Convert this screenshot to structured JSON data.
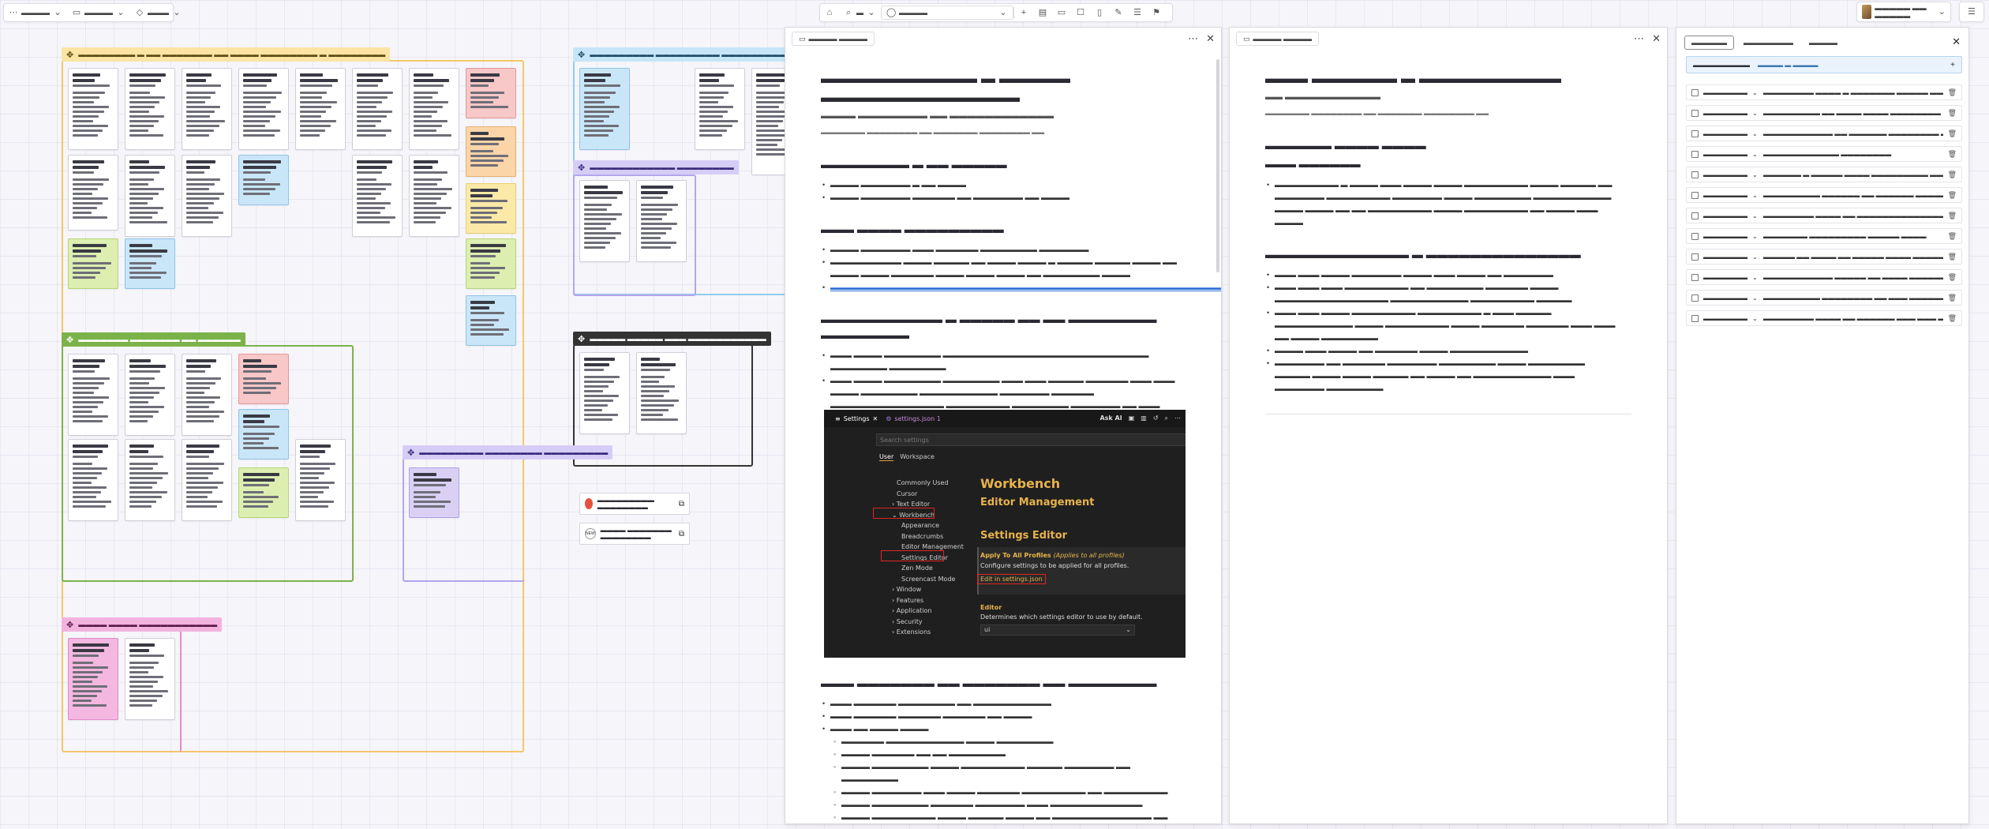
{
  "toolbar_left": {
    "items": [
      {
        "icon": "dots-icon",
        "label": "▬▬▬▬"
      },
      {
        "icon": "folder-icon",
        "label": "▬▬▬▬"
      },
      {
        "icon": "share-icon",
        "label": "▬▬▬"
      }
    ]
  },
  "toolbar_center": {
    "zoom_label": "▬",
    "selector_label": "▬▬▬▬"
  },
  "toolbar_right": {
    "workspace_label": "▬▬▬▬▬ ▬▬ ▬▬▬▬▬"
  },
  "canvas": {
    "frames": [
      {
        "label": "▬▬▬▬▬▬▬▬ ▬ ▬▬ ▬▬▬▬▬▬▬ ▬▬ ▬▬▬▬ ▬▬▬▬▬▬▬▬ ▬ ▬▬▬▬▬▬▬▬",
        "color": "#f3c86a"
      },
      {
        "label": "▬▬▬▬▬▬▬ ▬▬▬▬▬▬▬ ▬▬ ▬▬▬▬▬▬",
        "color": "#7bb34a"
      },
      {
        "label": "▬▬▬▬ ▬▬▬▬ ▬▬▬▬▬▬▬▬▬▬▬",
        "color": "#e68ac8"
      },
      {
        "label": "▬▬▬▬▬▬▬▬▬ ▬▬▬▬▬▬▬▬▬ ▬▬▬▬▬▬▬▬▬ ▬ ▬▬▬▬▬▬▬",
        "color": "#8fcbec"
      },
      {
        "label": "▬▬▬▬▬▬▬▬▬▬▬▬ ▬▬▬▬▬▬▬▬",
        "color": "#b4a6ec"
      },
      {
        "label": "▬▬▬▬▬ ▬▬▬▬▬ ▬▬▬ ▬▬▬▬▬▬▬▬▬▬▬",
        "color": "#333333"
      },
      {
        "label": "▬▬▬▬▬▬▬▬▬ ▬▬▬▬▬▬▬▬ ▬▬▬▬▬▬▬▬▬",
        "color": "#b4a6ec"
      }
    ],
    "links": [
      {
        "label": "▬▬▬▬▬▬▬▬▬ ▬▬▬▬▬▬▬▬"
      },
      {
        "label": "▬▬▬▬ ▬▬▬▬▬▬▬ ▬▬▬▬▬▬▬▬"
      }
    ]
  },
  "doc_panel_1": {
    "tab_label": "▬▬▬▬ ▬▬▬▬",
    "title": "▬▬▬▬▬▬▬▬▬▬▬ ▬ ▬▬▬▬▬ ▬▬▬▬▬▬▬▬▬▬▬▬▬▬",
    "subtitle": "▬▬▬▬ ▬▬▬▬▬▬▬▬ ▬▬ ▬▬▬▬▬▬▬▬▬▬▬▬",
    "meta": "▬▬▬▬▬▬▬ ▬▬▬▬▬▬▬▬ ▬▬      ▬▬▬▬▬▬▬ ▬▬▬▬▬▬▬▬ ▬▬",
    "sections": [
      {
        "heading": "▬▬▬▬▬▬▬▬ ▬ ▬▬ ▬▬▬▬▬",
        "bullets": [
          "▬▬▬▬ ▬▬▬▬▬▬▬ ▬ ▬▬ ▬▬▬▬",
          "▬▬▬▬ ▬▬▬▬▬▬▬ ▬▬▬▬▬▬ ▬▬ ▬▬▬▬▬▬▬ ▬▬ ▬▬▬▬"
        ]
      },
      {
        "heading": "▬▬▬ ▬▬▬▬ ▬▬▬▬▬▬▬▬▬",
        "bullets": [
          "▬▬▬▬ ▬▬▬▬▬▬▬ ▬▬▬ ▬▬▬▬▬▬ ▬▬▬▬▬▬▬▬ ▬▬▬▬▬▬▬",
          "▬▬▬▬▬▬▬▬▬▬ ▬▬▬▬ ▬▬▬▬▬ ▬▬ ▬▬▬▬ ▬▬▬▬ ▬ ▬▬▬▬▬ ▬▬▬▬▬ ▬▬▬▬ ▬▬ ▬▬▬▬ ▬▬▬▬ ▬▬▬▬▬▬ ▬▬▬▬ ▬▬▬▬ ▬▬▬▬ ▬▬ ▬▬▬▬▬▬▬▬ ▬▬▬▬"
        ],
        "link": "▬▬▬▬▬▬▬▬▬▬▬▬▬▬▬▬▬▬▬▬▬▬▬▬▬▬▬▬▬▬▬▬▬▬▬▬▬▬▬▬▬▬▬▬▬▬▬▬▬▬▬▬▬▬▬▬▬▬▬▬▬▬▬▬▬▬▬▬▬▬▬▬"
      },
      {
        "heading": "▬▬▬▬▬▬▬▬▬▬▬ ▬ ▬▬▬▬▬ ▬▬ ▬▬ ▬▬▬▬▬▬▬▬ ▬▬▬▬▬▬▬▬",
        "bullets": [
          "▬▬▬ ▬▬▬▬ ▬▬▬▬▬▬▬▬ ▬▬▬▬▬▬▬▬▬▬▬▬▬▬▬▬▬▬▬▬▬▬▬▬▬▬▬▬▬ ▬▬▬▬▬▬▬▬ ▬▬▬▬▬▬▬▬",
          "▬▬▬ ▬▬▬▬ ▬▬▬▬▬▬▬▬ ▬▬▬▬▬▬▬▬ ▬▬▬ ▬▬▬ ▬▬▬▬▬ ▬▬▬▬▬▬ ▬▬▬ ▬▬▬ ▬▬▬▬ ▬▬▬▬▬▬▬▬ ▬▬▬▬▬▬▬▬▬▬▬ ▬▬▬▬▬▬▬ ▬▬▬▬▬▬ ▬▬▬▬▬▬▬▬▬▬▬▬▬▬▬▬ ▬▬▬▬▬▬▬▬▬ ▬▬▬▬▬▬▬▬ ▬▬▬▬▬▬▬ ▬▬ ▬▬▬ ▬▬▬▬▬▬▬▬ ▬▬▬▬ ▬▬▬▬▬▬▬▬"
        ]
      },
      {
        "heading": "▬▬▬ ▬▬▬▬▬▬▬ ▬▬ ▬▬▬▬▬▬▬ ▬▬ ▬▬▬▬▬▬▬▬",
        "bullets": [
          "▬▬▬ ▬▬▬▬▬▬ ▬▬▬▬▬▬▬▬ ▬▬ ▬▬▬▬▬▬▬▬▬▬▬",
          "▬▬▬ ▬▬▬▬▬▬ ▬▬▬▬▬▬ ▬▬▬▬▬▬ ▬▬ ▬▬▬▬",
          "▬▬▬ ▬▬ ▬▬▬▬ ▬▬▬▬"
        ],
        "subbullets": [
          "▬▬▬▬▬▬ ▬▬▬▬▬▬▬▬▬▬▬ ▬▬▬▬ ▬▬▬▬▬▬▬▬",
          "▬▬▬▬ ▬▬▬▬▬▬ ▬▬ ▬▬ ▬▬▬▬▬▬▬▬",
          "▬▬▬▬ ▬▬▬▬▬▬▬▬ ▬▬▬▬ ▬▬▬▬▬▬▬▬▬ ▬▬▬▬▬ ▬▬▬▬▬▬▬ ▬▬ ▬▬▬▬▬▬▬▬",
          "▬▬▬▬ ▬▬▬▬▬▬▬ ▬▬▬ ▬▬▬▬ ▬▬▬▬▬▬ ▬▬▬▬▬▬▬▬▬ ▬▬ ▬▬▬▬▬▬▬▬▬",
          "▬▬▬▬ ▬▬▬▬▬▬▬▬ ▬▬▬▬▬▬ ▬▬▬▬▬▬▬ ▬▬▬ ▬▬▬▬▬▬▬▬▬▬▬▬▬",
          "▬▬▬▬ ▬▬▬▬▬▬▬▬▬ ▬▬▬▬ ▬▬▬▬▬ ▬▬▬▬ ▬▬ ▬▬▬▬▬▬▬▬▬▬▬▬▬▬ ▬▬ ▬▬▬"
        ]
      }
    ]
  },
  "vscode": {
    "tabs": [
      "Settings",
      "settings.json 1"
    ],
    "ask_ai": "Ask AI",
    "search_placeholder": "Search settings",
    "scopes": [
      "User",
      "Workspace"
    ],
    "tree": [
      "Commonly Used",
      "Cursor",
      "Text Editor",
      "Workbench",
      "Appearance",
      "Breadcrumbs",
      "Editor Management",
      "Settings Editor",
      "Zen Mode",
      "Screencast Mode",
      "Window",
      "Features",
      "Application",
      "Security",
      "Extensions"
    ],
    "section_title": "Workbench",
    "section_sub": "Editor Management",
    "settings_title": "Settings Editor",
    "apply_label": "Apply To All Profiles",
    "apply_note": "(Applies to all profiles)",
    "apply_desc": "Configure settings to be applied for all profiles.",
    "edit_link": "Edit in settings.json",
    "editor_label": "Editor",
    "editor_desc": "Determines which settings editor to use by default.",
    "editor_value": "ui"
  },
  "doc_panel_2": {
    "tab_label": "▬▬▬▬ ▬▬▬▬",
    "title": "▬▬▬ ▬▬▬▬▬▬ ▬ ▬▬▬▬▬▬▬▬▬▬",
    "subtitle": "▬▬ ▬▬▬▬▬▬▬▬▬▬▬",
    "meta": "▬▬▬▬▬▬▬ ▬▬▬▬▬▬▬▬ ▬▬      ▬▬▬▬▬▬▬ ▬▬▬▬▬▬▬▬ ▬▬",
    "sections": [
      {
        "heading": "▬▬▬▬▬▬ ▬▬▬▬ ▬▬▬▬",
        "subheading": "▬▬▬ ▬▬▬▬▬▬",
        "bullets": [
          "▬▬▬▬▬▬▬▬▬ ▬ ▬▬▬▬ ▬▬▬ ▬▬▬▬ ▬▬▬▬ ▬▬▬▬▬▬▬▬▬ ▬▬▬▬ ▬▬▬▬▬ ▬▬ ▬▬▬▬▬▬▬ ▬▬▬▬▬▬▬▬▬ ▬▬▬▬▬▬▬ ▬▬▬▬ ▬▬▬▬▬▬▬▬ ▬▬▬▬▬▬▬▬▬▬▬ ▬▬▬▬ ▬▬▬▬ ▬▬ ▬▬ ▬▬▬▬▬▬▬▬▬ ▬▬▬▬ ▬▬▬▬▬▬▬▬▬ ▬▬ ▬▬▬▬ ▬▬▬ ▬▬▬▬"
        ]
      },
      {
        "heading": "▬▬▬▬▬▬▬▬▬▬▬▬▬ ▬ ▬▬▬▬▬▬▬▬▬▬▬▬▬▬",
        "bullets": [
          "▬▬▬ ▬▬▬ ▬▬▬▬ ▬▬▬▬▬▬▬ ▬▬▬▬ ▬▬▬ ▬▬▬▬ ▬▬ ▬▬▬▬▬▬▬",
          "▬▬▬ ▬▬▬ ▬▬▬ ▬▬▬▬▬▬▬▬▬ ▬▬ ▬▬▬▬▬▬▬▬ ▬▬▬▬▬▬ ▬▬▬▬ ▬▬▬▬▬▬▬▬▬▬▬▬▬▬▬▬ ▬▬▬▬▬▬▬▬▬▬▬ ▬▬▬▬▬▬▬▬▬ ▬▬▬▬▬",
          "▬▬▬ ▬▬▬ ▬▬▬▬ ▬▬▬▬▬▬▬▬▬ ▬▬▬▬▬▬▬▬▬ ▬ ▬▬▬ ▬▬▬▬▬ ▬▬▬▬▬▬▬▬▬▬▬ ▬▬▬▬ ▬▬▬▬▬▬▬▬▬ ▬▬▬▬ ▬▬▬▬▬▬ ▬▬▬▬▬▬ ▬▬▬ ▬▬▬ ▬▬ ▬▬▬▬ ▬▬▬▬▬▬▬▬",
          "▬▬▬▬ ▬▬▬ ▬▬▬▬ ▬▬ ▬▬▬▬▬▬ ▬▬▬▬ ▬▬▬▬▬▬▬▬▬▬▬",
          "▬▬▬▬▬▬▬ ▬▬ ▬▬▬▬▬▬ ▬▬▬▬▬▬▬ ▬▬▬▬▬▬▬▬ ▬▬▬▬ ▬▬▬▬▬▬▬▬ ▬▬▬▬▬ ▬▬▬▬ ▬▬▬▬ ▬▬▬▬▬ ▬▬ ▬▬▬▬ ▬▬ ▬▬▬▬▬▬▬▬▬▬▬ ▬▬▬ ▬▬▬▬▬▬▬ ▬▬▬▬▬▬▬▬"
        ]
      }
    ]
  },
  "tasks_panel": {
    "tabs": [
      "▬▬▬▬▬",
      "▬▬▬▬▬▬▬",
      "▬▬▬▬"
    ],
    "filter_label": "▬▬▬▬▬▬▬▬▬",
    "filter_value": "▬▬▬▬ ▬ ▬▬▬▬",
    "rows": [
      {
        "status": "▬▬▬▬▬▬▬",
        "text": "▬▬▬▬▬▬▬▬ ▬▬▬▬ ▬ ▬▬▬▬▬▬▬ ▬▬▬▬▬ ▬▬▬ ▬▬▬ ▬▬▬▬▬▬▬ ▬▬▬ ▬▬▬▬▬▬▬▬"
      },
      {
        "status": "▬▬▬▬▬▬▬",
        "text": "▬▬▬▬▬▬▬▬▬ ▬▬ ▬▬▬▬ ▬▬▬▬ ▬▬▬▬▬▬▬▬"
      },
      {
        "status": "▬▬▬▬▬▬▬",
        "text": "▬▬▬▬▬▬▬▬▬▬▬ ▬▬ ▬▬▬▬▬▬ ▬▬▬▬▬▬▬▬ ▬▬▬▬▬▬▬▬▬"
      },
      {
        "status": "▬▬▬▬▬▬▬",
        "text": "▬▬▬▬▬▬▬▬▬▬▬▬ ▬▬▬▬▬▬▬▬"
      },
      {
        "status": "▬▬▬▬▬▬▬",
        "text": "▬▬▬▬▬▬ ▬ ▬▬▬▬▬ ▬▬▬▬ ▬▬▬▬▬▬▬▬▬ ▬▬▬▬▬▬▬▬▬ ▬▬▬▬▬▬▬▬▬▬▬▬▬▬▬"
      },
      {
        "status": "▬▬▬▬▬▬▬",
        "text": "▬▬▬▬▬▬▬▬▬ ▬▬▬▬▬▬ ▬▬ ▬▬▬▬▬▬ ▬▬▬▬▬▬ ▬▬▬▬▬▬▬▬▬▬"
      },
      {
        "status": "▬▬▬▬▬▬▬",
        "text": "▬▬▬▬▬▬▬▬ ▬▬▬▬ ▬▬ ▬▬▬▬▬▬▬▬▬▬▬▬▬▬▬▬▬"
      },
      {
        "status": "▬▬▬▬▬▬▬",
        "text": "▬▬▬▬▬▬▬ ▬▬▬▬▬▬▬▬▬ ▬▬▬▬▬ ▬▬▬▬"
      },
      {
        "status": "▬▬▬▬▬▬▬",
        "text": "▬▬▬▬▬ ▬▬ ▬▬▬▬ ▬▬ ▬▬▬▬▬ ▬▬▬▬ ▬▬▬▬▬▬▬▬▬▬▬▬▬"
      },
      {
        "status": "▬▬▬▬▬▬▬",
        "text": "▬▬▬▬▬▬▬▬▬▬▬ ▬▬▬▬▬ ▬▬ ▬▬▬▬ ▬▬▬▬▬▬ ▬▬ ▬▬▬▬▬▬ ▬▬▬▬▬▬▬"
      },
      {
        "status": "▬▬▬▬▬▬▬",
        "text": "▬▬▬▬▬▬▬▬▬ ▬▬▬▬▬▬▬▬ ▬▬ ▬▬▬ ▬▬▬▬▬▬▬▬▬"
      },
      {
        "status": "▬▬▬▬▬▬▬",
        "text": "▬▬▬▬▬▬▬▬ ▬▬▬▬ ▬▬ ▬▬▬▬▬▬ ▬▬▬ ▬▬▬ ▬▬▬▬▬ ▬▬ ▬▬▬▬▬▬▬▬"
      }
    ]
  }
}
